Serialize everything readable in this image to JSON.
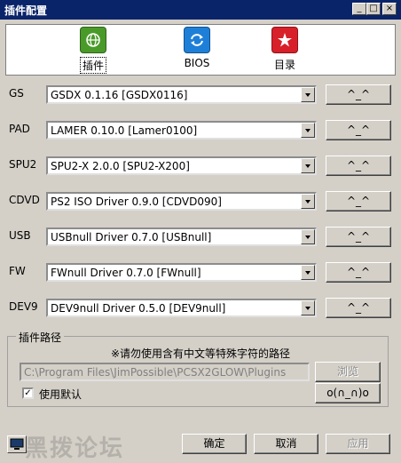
{
  "window": {
    "title": "插件配置",
    "controls": [
      "_",
      "□",
      "×"
    ]
  },
  "tabs": [
    {
      "label": "插件",
      "icon": "globe-icon",
      "color": "#4a9a2a"
    },
    {
      "label": "BIOS",
      "icon": "refresh-icon",
      "color": "#1e7fd8"
    },
    {
      "label": "目录",
      "icon": "star-icon",
      "color": "#d8202a"
    }
  ],
  "plugins": [
    {
      "label": "GS",
      "value": "GSDX  0.1.16 [GSDX0116]",
      "button": "^_^"
    },
    {
      "label": "PAD",
      "value": "LAMER 0.10.0 [Lamer0100]",
      "button": "^_^"
    },
    {
      "label": "SPU2",
      "value": "SPU2-X 2.0.0 [SPU2-X200]",
      "button": "^_^"
    },
    {
      "label": "CDVD",
      "value": "PS2 ISO Driver 0.9.0 [CDVD090]",
      "button": "^_^"
    },
    {
      "label": "USB",
      "value": "USBnull Driver 0.7.0 [USBnull]",
      "button": "^_^"
    },
    {
      "label": "FW",
      "value": "FWnull Driver 0.7.0 [FWnull]",
      "button": "^_^"
    },
    {
      "label": "DEV9",
      "value": "DEV9null Driver 0.5.0 [DEV9null]",
      "button": "^_^"
    }
  ],
  "plugin_path": {
    "group_title": "插件路径",
    "note": "※请勿使用含有中文等特殊字符的路径",
    "path": "C:\\Program Files\\JimPossible\\PCSX2GLOW\\Plugins",
    "browse_label": "浏览",
    "use_default_label": "使用默认",
    "use_default_checked": true,
    "emoticon_button": "o(∩_∩)o"
  },
  "footer": {
    "ok_label": "确定",
    "cancel_label": "取消",
    "apply_label": "应用",
    "watermark": "黑拨论坛"
  }
}
